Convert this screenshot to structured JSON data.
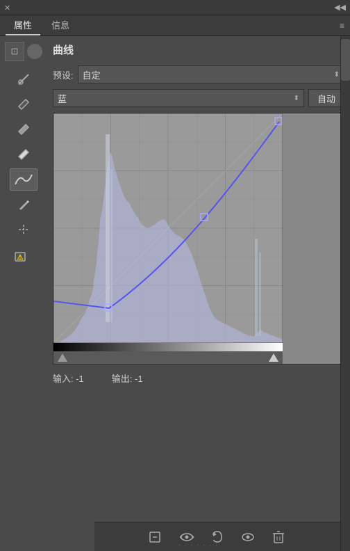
{
  "titlebar": {
    "close_icon": "✕",
    "double_arrow": "◀▶"
  },
  "tabs": [
    {
      "label": "属性",
      "active": true
    },
    {
      "label": "信息",
      "active": false
    }
  ],
  "panel": {
    "title": "曲线",
    "preset_label": "预设:",
    "preset_value": "自定",
    "channel_value": "蓝",
    "auto_button": "自动",
    "input_label": "输入: -1",
    "output_label": "输出: -1"
  },
  "toolbar_tools": [
    {
      "name": "curves-tool",
      "icon": "∿",
      "active": true
    },
    {
      "name": "eyedropper-tool",
      "icon": "✏",
      "active": false
    },
    {
      "name": "eyedropper-dark-tool",
      "icon": "✒",
      "active": false
    },
    {
      "name": "eyedropper-mid-tool",
      "icon": "✒",
      "active": false
    },
    {
      "name": "eyedropper-light-tool",
      "icon": "✒",
      "active": false
    },
    {
      "name": "smooth-tool",
      "icon": "〜",
      "active": false
    },
    {
      "name": "pencil-tool",
      "icon": "✎",
      "active": false
    },
    {
      "name": "node-tool",
      "icon": "⌇",
      "active": false
    },
    {
      "name": "warning-tool",
      "icon": "⚠",
      "active": false
    }
  ],
  "bottom_buttons": [
    {
      "name": "reset-layer-button",
      "icon": "⊡"
    },
    {
      "name": "eye-button",
      "icon": "◉"
    },
    {
      "name": "undo-button",
      "icon": "↺"
    },
    {
      "name": "visibility-button",
      "icon": "👁"
    },
    {
      "name": "delete-button",
      "icon": "🗑"
    }
  ],
  "histogram": {
    "color": "rgba(180,185,220,0.7)",
    "curve_color": "#4444cc"
  }
}
